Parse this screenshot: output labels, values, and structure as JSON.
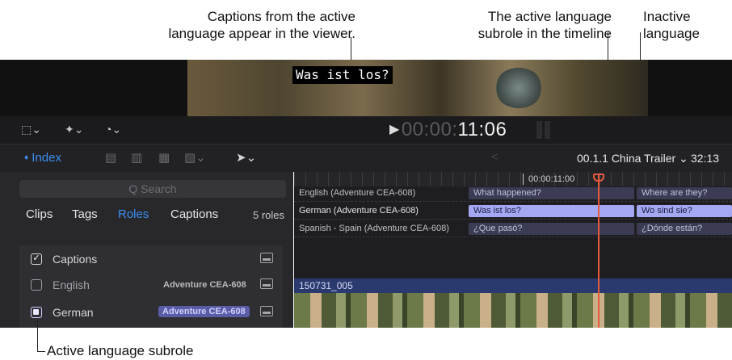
{
  "annotations": {
    "viewer_captions": [
      "Captions from the active",
      "language appear in the viewer."
    ],
    "active_subrole_timeline": [
      "The active language",
      "subrole in the timeline"
    ],
    "inactive_language": [
      "Inactive",
      "language"
    ],
    "active_subrole": "Active language subrole"
  },
  "viewer": {
    "caption_text": "Was ist los?"
  },
  "toolbar": {
    "play_icon": "▶",
    "timecode_dim": "00:00:",
    "timecode_bright": "11:06"
  },
  "bar2": {
    "index_label": "Index",
    "index_icon": "♦",
    "back_icon": "<",
    "project_name": "00.1.1 China Trailer ⌄",
    "duration": "32:13"
  },
  "index_panel": {
    "search_placeholder": "Q Search",
    "tabs": [
      "Clips",
      "Tags",
      "Roles",
      "Captions"
    ],
    "active_tab": "Roles",
    "roles_count": "5 roles",
    "roles": [
      {
        "name": "Captions",
        "tag": "",
        "checked": true
      },
      {
        "name": "English",
        "tag": "Adventure CEA-608",
        "checked": false
      },
      {
        "name": "German",
        "tag": "Adventure CEA-608",
        "checked": false,
        "active": true
      }
    ]
  },
  "timeline": {
    "ruler_time": "00:00:11:00",
    "lanes": [
      {
        "label": "English (Adventure CEA-608)",
        "clips": [
          "What happened?",
          "Where are they?"
        ],
        "active": false
      },
      {
        "label": "German (Adventure CEA-608)",
        "clips": [
          "Was ist los?",
          "Wo sind sie?"
        ],
        "active": true
      },
      {
        "label": "Spanish - Spain (Adventure CEA-608)",
        "clips": [
          "¿Que pasó?",
          "¿Dónde están?"
        ],
        "active": false
      }
    ],
    "clip_name": "150731_005"
  },
  "colors": {
    "accent": "#3c8ef0",
    "active_caption": "#a4a7f2",
    "inactive_caption": "#3b3c54",
    "playhead": "#e55a3c"
  }
}
